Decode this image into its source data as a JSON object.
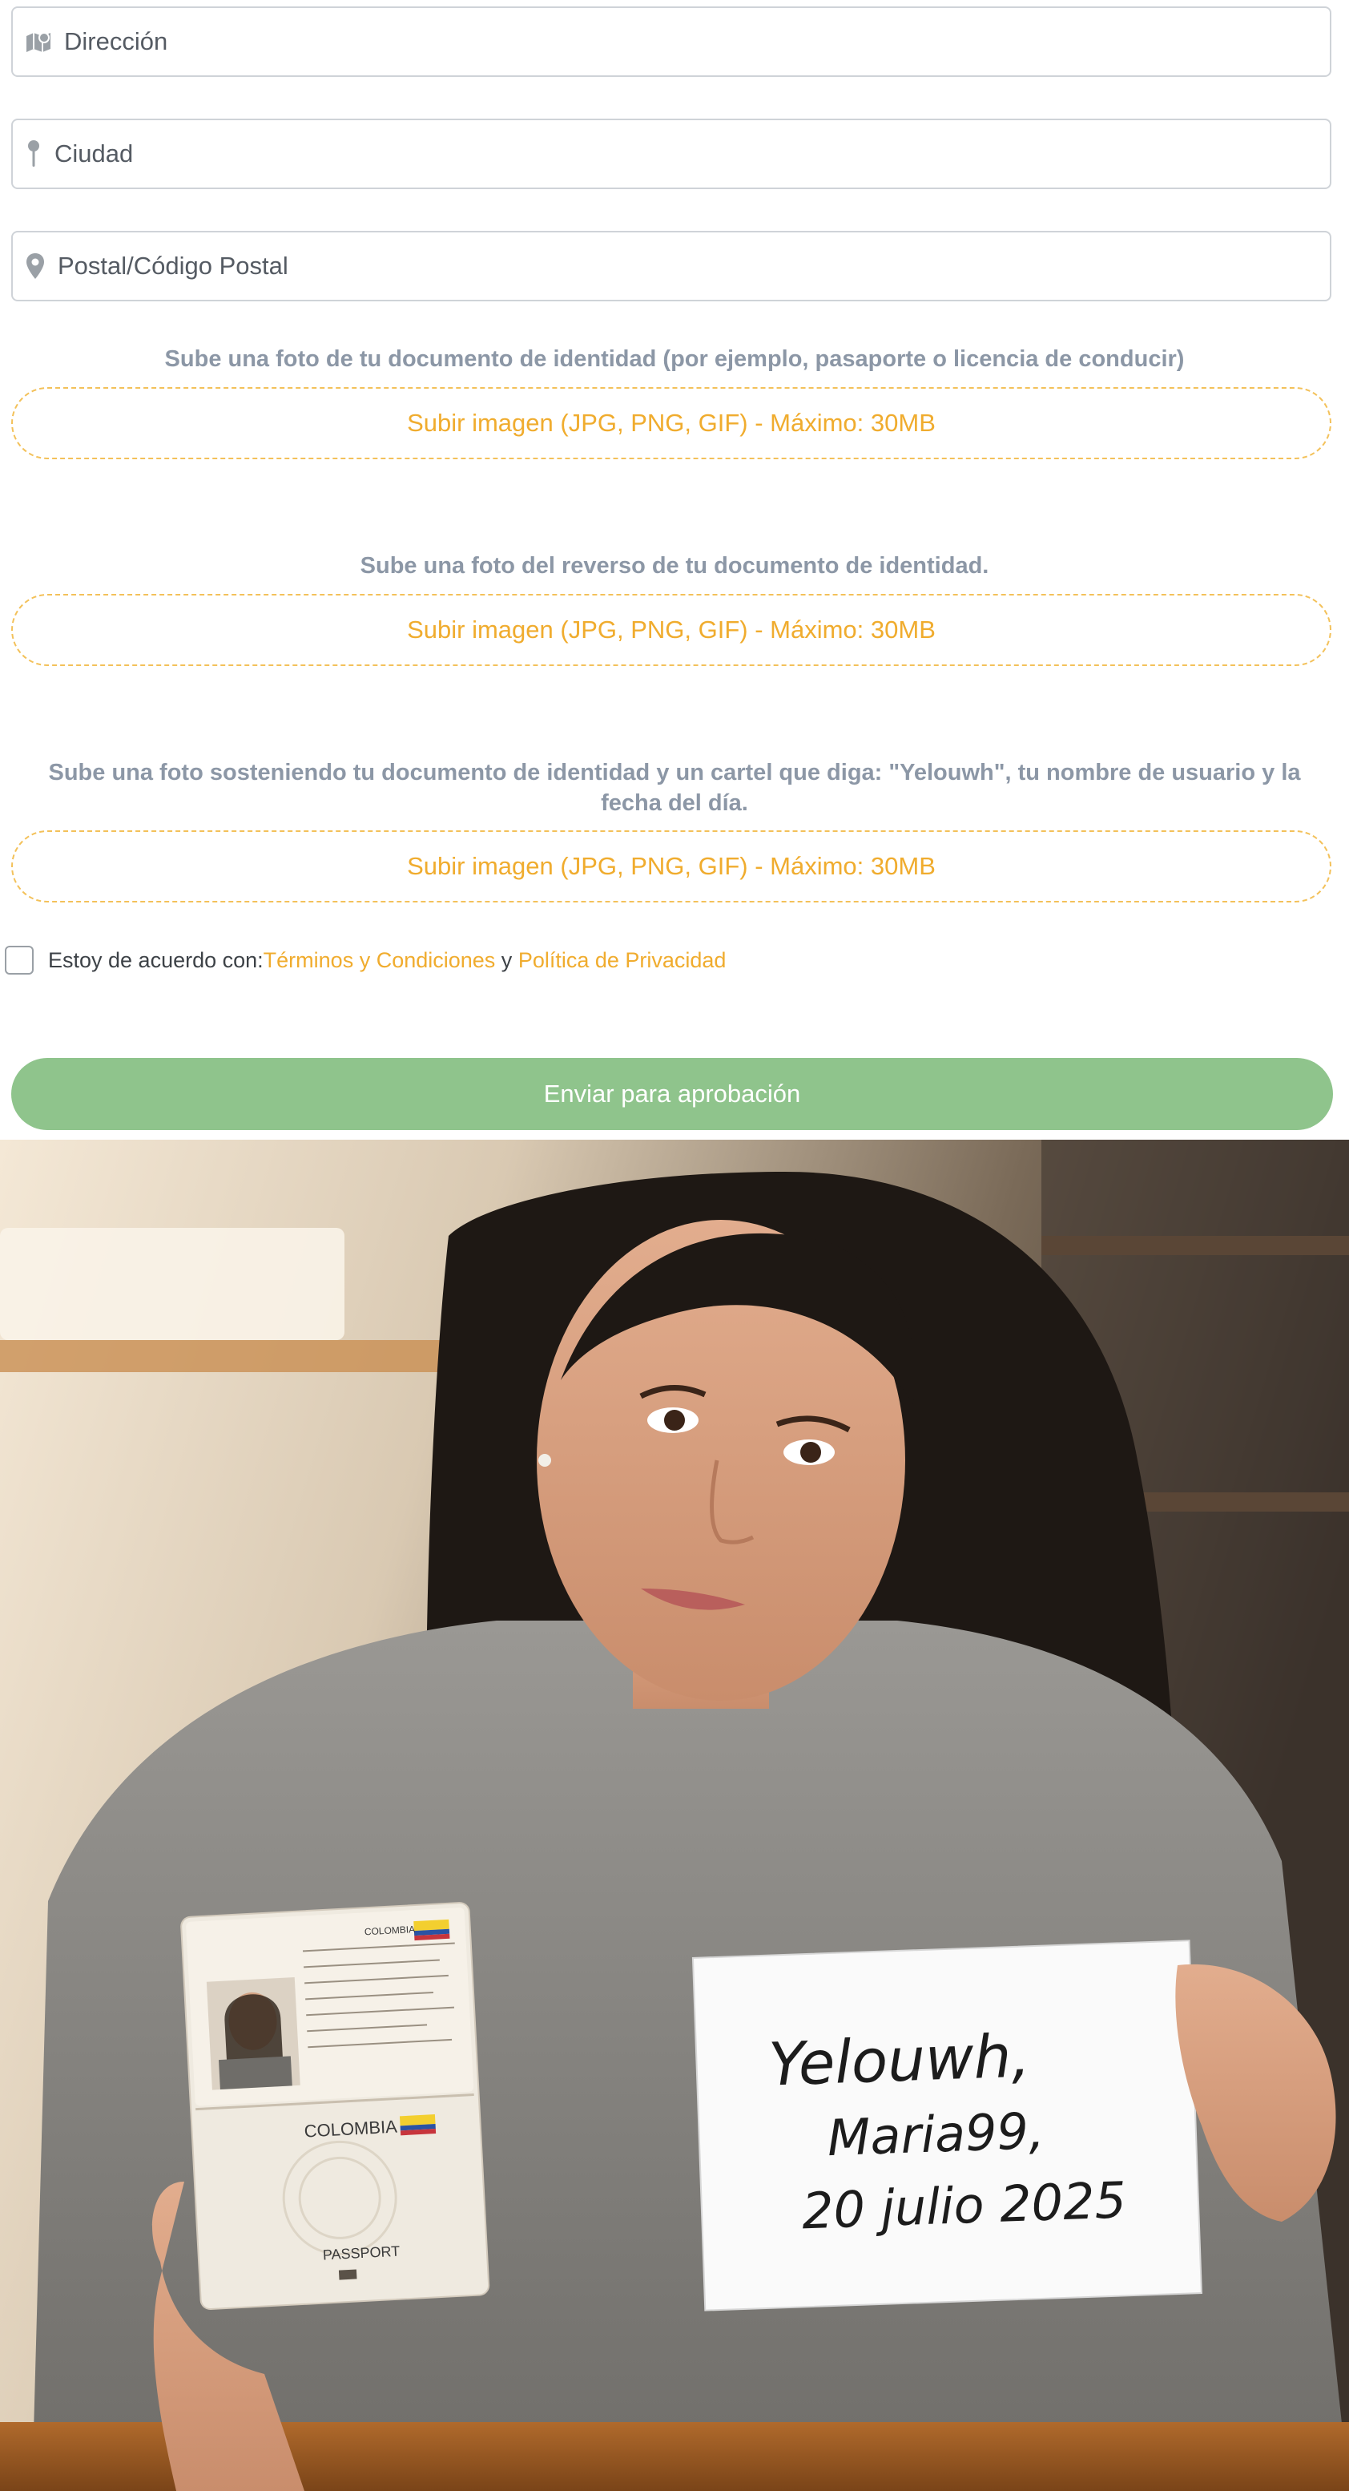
{
  "form": {
    "address": {
      "placeholder": "Dirección",
      "icon": "map-icon"
    },
    "city": {
      "placeholder": "Ciudad",
      "icon": "pin-icon"
    },
    "postal": {
      "placeholder": "Postal/Código Postal",
      "icon": "location-marker-icon"
    },
    "uploads": [
      {
        "label": "Sube una foto de tu documento de identidad (por ejemplo, pasaporte o licencia de conducir)",
        "button": "Subir imagen (JPG, PNG, GIF) - Máximo: 30MB"
      },
      {
        "label": "Sube una foto del reverso de tu documento de identidad.",
        "button": "Subir imagen (JPG, PNG, GIF) - Máximo: 30MB"
      },
      {
        "label": "Sube una foto sosteniendo tu documento de identidad y un cartel que diga: \"Yelouwh\", tu nombre de usuario y la fecha del día.",
        "button": "Subir imagen (JPG, PNG, GIF) - Máximo: 30MB"
      }
    ],
    "agree": {
      "prefix": "Estoy de acuerdo con: ",
      "terms": "Términos y Condiciones",
      "joiner": " y ",
      "privacy": "Política de Privacidad",
      "checked": false
    },
    "submit_label": "Enviar para aprobación"
  },
  "photo": {
    "sign_lines": [
      "Yelouwh,",
      "Maria99,",
      "20 julio 2025"
    ],
    "passport_country": "COLOMBIA",
    "passport_label": "PASSPORT",
    "passport_header_country": "COLOMBIA"
  },
  "colors": {
    "accent": "#f0ac2e",
    "submit": "#8fc48c",
    "label": "#8c97a6",
    "border": "#cfd3d8"
  }
}
